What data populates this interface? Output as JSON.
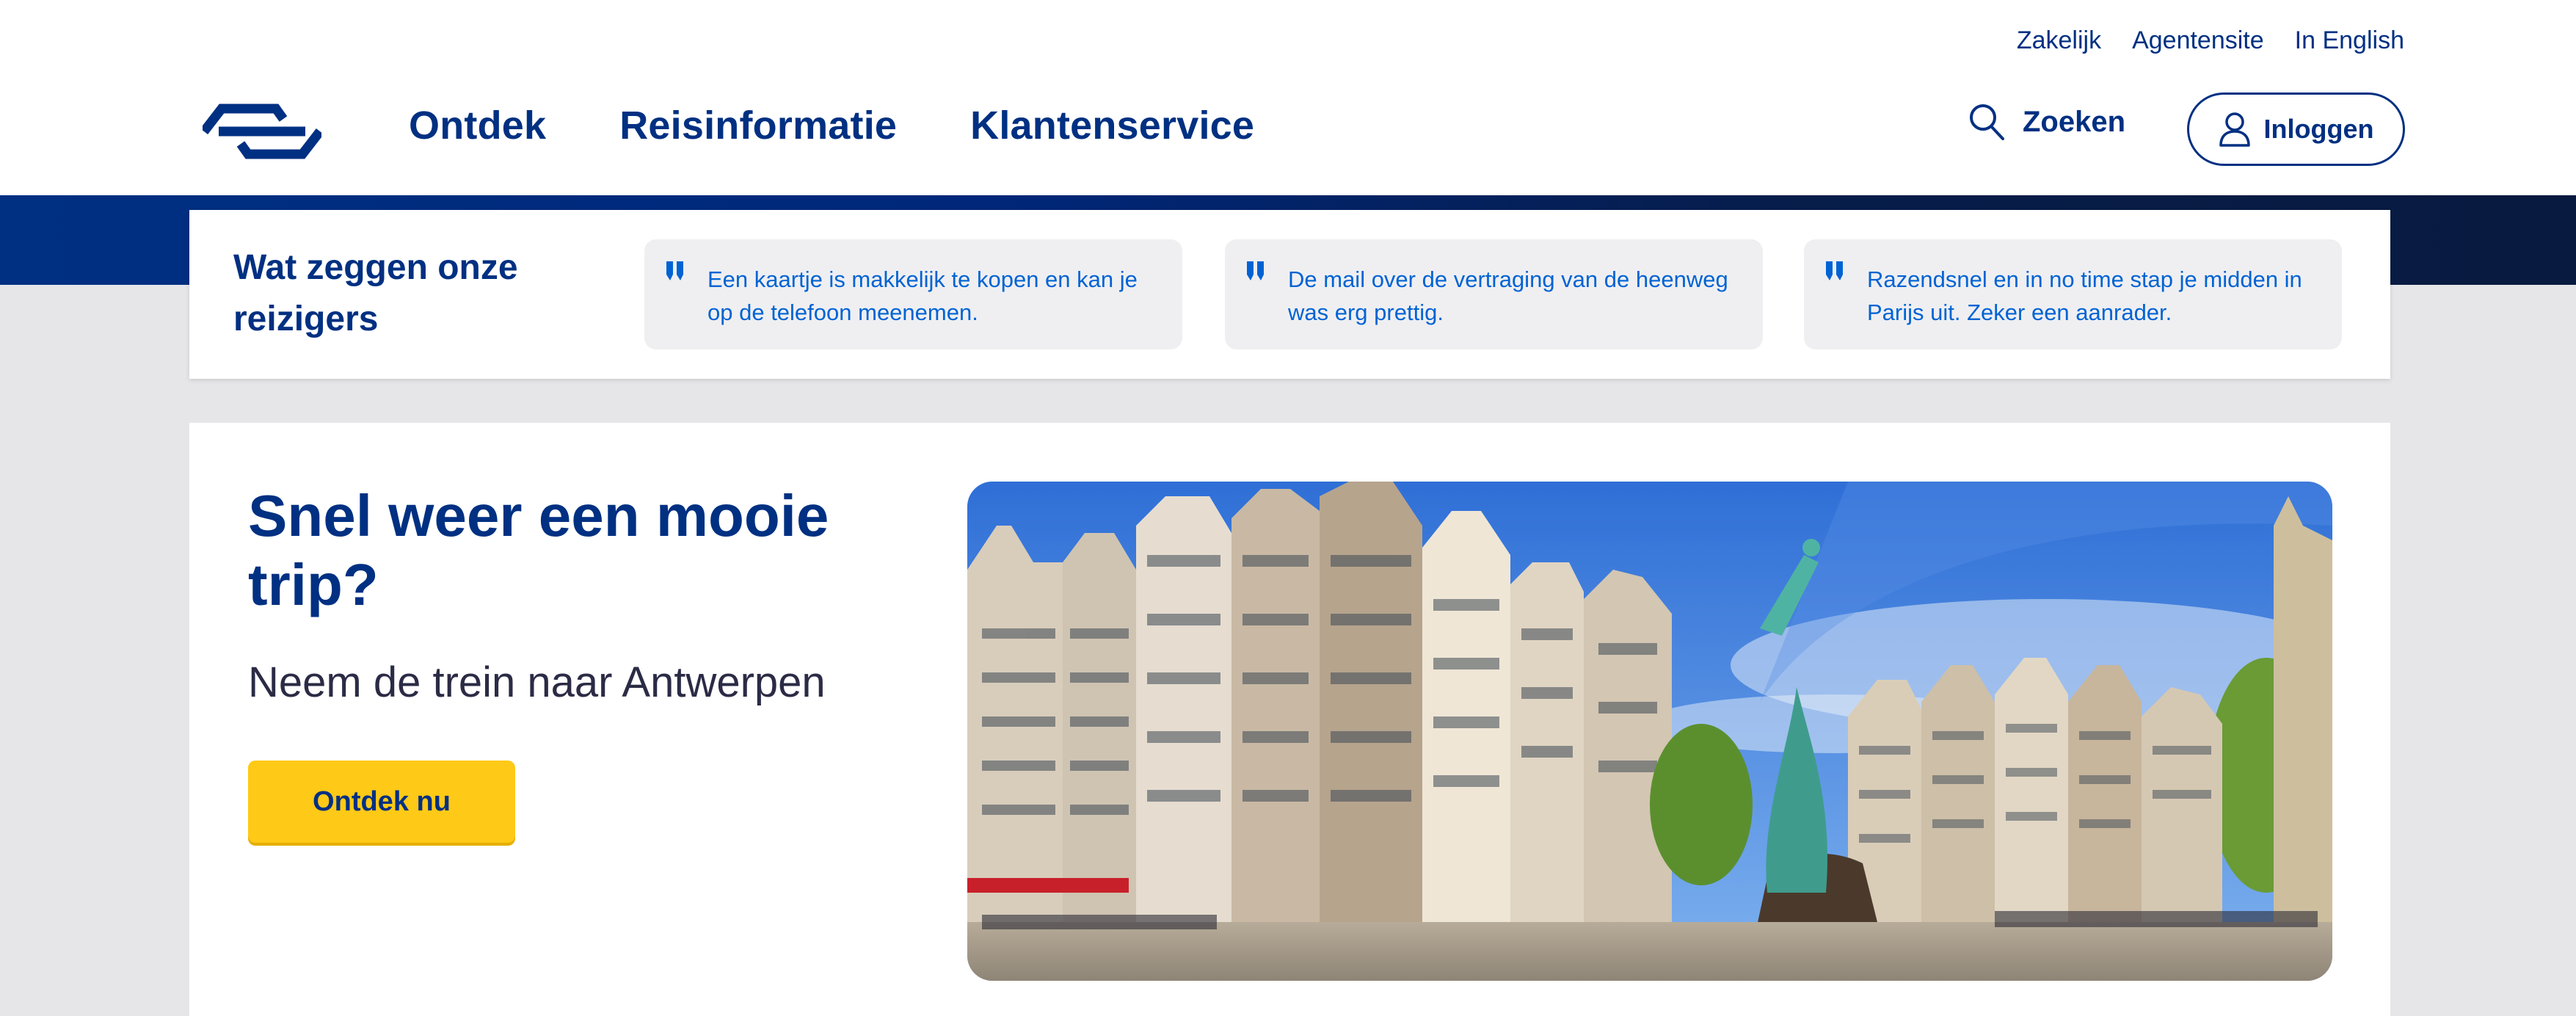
{
  "utility_nav": {
    "items": [
      "Zakelijk",
      "Agentensite",
      "In English"
    ]
  },
  "logo": {
    "icon": "ns-logo-icon",
    "color": "#003082"
  },
  "main_nav": {
    "items": [
      "Ontdek",
      "Reisinformatie",
      "Klantenservice"
    ]
  },
  "search": {
    "label": "Zoeken",
    "icon": "search-icon"
  },
  "login": {
    "label": "Inloggen",
    "icon": "user-icon"
  },
  "reviews": {
    "title": "Wat zeggen onze reizigers",
    "quotes": [
      "Een kaartje is makkelijk te kopen en kan je op de telefoon meenemen.",
      "De mail over de vertraging van de heenweg was erg prettig.",
      "Razendsnel en in no time stap je midden in Parijs uit. Zeker een aanrader."
    ]
  },
  "hero": {
    "title": "Snel weer een mooie trip?",
    "subtitle": "Neem de trein naar Antwerpen",
    "cta_label": "Ontdek nu",
    "image": "antwerp-grote-markt-photo"
  },
  "colors": {
    "brand_blue": "#003082",
    "accent_yellow": "#ffc917",
    "quote_text": "#0063d3",
    "page_background": "#e6e6e9"
  }
}
